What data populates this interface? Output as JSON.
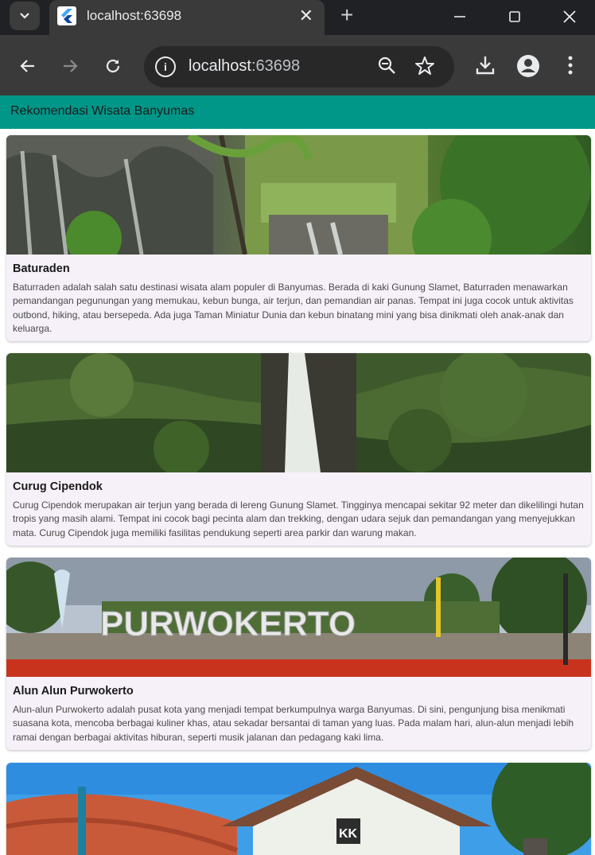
{
  "browser": {
    "tab_title": "localhost:63698",
    "url_host": "localhost",
    "url_port": ":63698",
    "icons": [
      "tab-search-icon",
      "flutter-favicon-icon",
      "close-icon",
      "plus-icon",
      "minimize-icon",
      "maximize-icon",
      "window-close-icon",
      "back-arrow-icon",
      "forward-arrow-icon",
      "reload-icon",
      "info-icon",
      "zoom-out-icon",
      "star-icon",
      "download-icon",
      "profile-icon",
      "more-vert-icon"
    ]
  },
  "app": {
    "title": "Rekomendasi Wisata Banyumas",
    "accent": "#009688",
    "card_bg": "#f6f0f9"
  },
  "places": [
    {
      "name": "Baturaden",
      "description": "Baturraden adalah salah satu destinasi wisata alam populer di Banyumas. Berada di kaki Gunung Slamet, Baturraden menawarkan pemandangan pegunungan yang memukau, kebun bunga, air terjun, dan pemandian air panas. Tempat ini juga cocok untuk aktivitas outbond, hiking, atau bersepeda. Ada juga Taman Miniatur Dunia dan kebun binatang mini yang bisa dinikmati oleh anak-anak dan keluarga."
    },
    {
      "name": "Curug Cipendok",
      "description": "Curug Cipendok merupakan air terjun yang berada di lereng Gunung Slamet. Tingginya mencapai sekitar 92 meter dan dikelilingi hutan tropis yang masih alami. Tempat ini cocok bagi pecinta alam dan trekking, dengan udara sejuk dan pemandangan yang menyejukkan mata. Curug Cipendok juga memiliki fasilitas pendukung seperti area parkir dan warung makan."
    },
    {
      "name": "Alun Alun Purwokerto",
      "description": "Alun-alun Purwokerto adalah pusat kota yang menjadi tempat berkumpulnya warga Banyumas. Di sini, pengunjung bisa menikmati suasana kota, mencoba berbagai kuliner khas, atau sekadar bersantai di taman yang luas. Pada malam hari, alun-alun menjadi lebih ramai dengan berbagai aktivitas hiburan, seperti musik jalanan dan pedagang kaki lima.",
      "image_sign_text": "PURWOKERTO"
    },
    {
      "name": "",
      "description": "",
      "image_sign_text": "KK"
    }
  ]
}
